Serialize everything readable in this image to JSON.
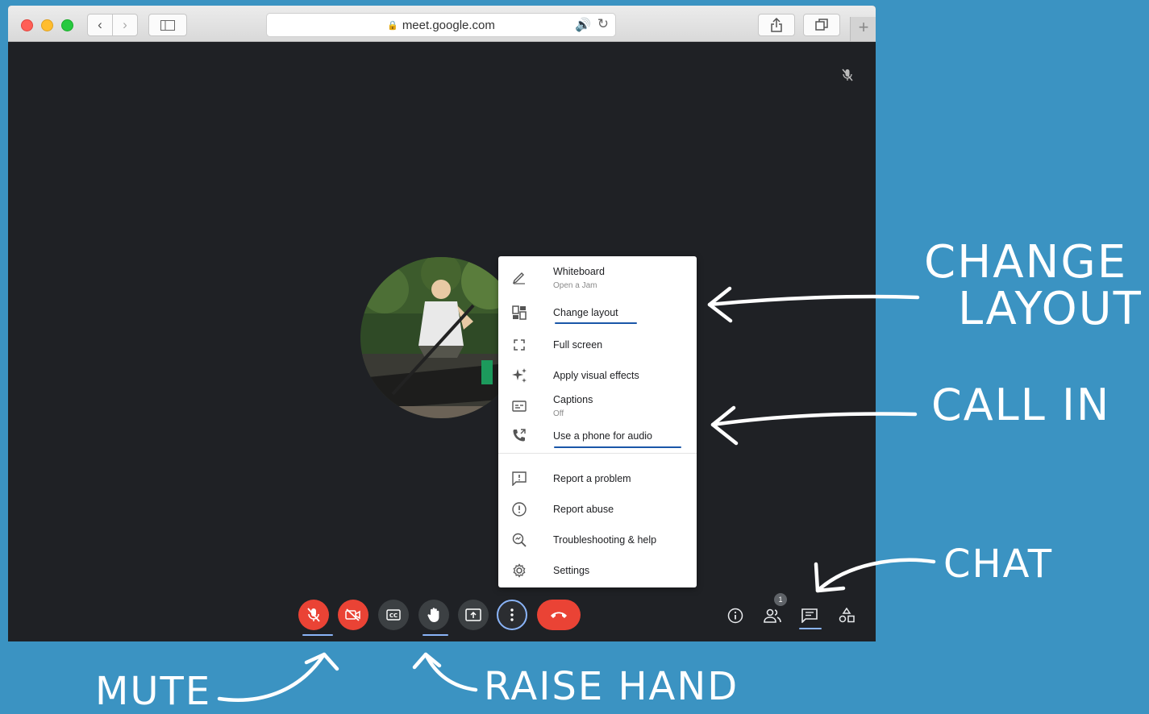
{
  "browser": {
    "url": "meet.google.com"
  },
  "menu": {
    "items": [
      {
        "label": "Whiteboard",
        "sub": "Open a Jam",
        "icon": "pencil-icon"
      },
      {
        "label": "Change layout",
        "icon": "layout-icon"
      },
      {
        "label": "Full screen",
        "icon": "fullscreen-icon"
      },
      {
        "label": "Apply visual effects",
        "icon": "sparkle-icon"
      },
      {
        "label": "Captions",
        "sub": "Off",
        "icon": "captions-icon"
      },
      {
        "label": "Use a phone for audio",
        "icon": "phone-icon"
      },
      {
        "label": "Report a problem",
        "icon": "report-problem-icon"
      },
      {
        "label": "Report abuse",
        "icon": "report-abuse-icon"
      },
      {
        "label": "Troubleshooting & help",
        "icon": "troubleshoot-icon"
      },
      {
        "label": "Settings",
        "icon": "gear-icon"
      }
    ]
  },
  "controls": {
    "participants_count": "1"
  },
  "annotations": {
    "change_layout": [
      "CHANGE",
      "LAYOUT"
    ],
    "call_in": "CALL IN",
    "chat": "CHAT",
    "mute": "MUTE",
    "raise_hand": "RAISE HAND"
  },
  "colors": {
    "background": "#3b93c2",
    "meeting_bg": "#1f2125",
    "red_control": "#ea4335",
    "underline": "#1a56a8"
  }
}
